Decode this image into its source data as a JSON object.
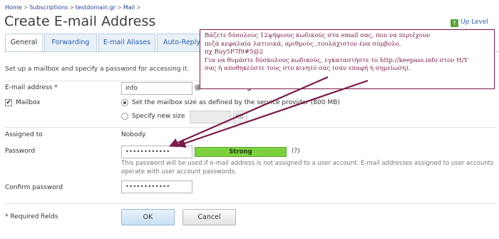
{
  "breadcrumb": {
    "items": [
      "Home",
      "Subscriptions",
      "testdomain.gr",
      "Mail"
    ],
    "separator": ">"
  },
  "page_title": "Create E-mail Address",
  "up_level": {
    "label": "Up Level",
    "icon": "up-level-icon"
  },
  "tabs": [
    {
      "label": "General",
      "active": true
    },
    {
      "label": "Forwarding",
      "active": false
    },
    {
      "label": "E-mail Aliases",
      "active": false
    },
    {
      "label": "Auto-Reply",
      "active": false
    }
  ],
  "intro": "Set up a mailbox and specify a password for accessing it.",
  "form": {
    "email": {
      "label": "E-mail address *",
      "value": "info",
      "domain": "@ testdomain.gr"
    },
    "mailbox": {
      "label": "Mailbox",
      "checked": true,
      "option_default": "Set the mailbox size as defined by the service provider (800 MB)",
      "option_custom": "Specify new size",
      "unit": "KB"
    },
    "assigned_to": {
      "label": "Assigned to",
      "value": "Nobody"
    },
    "password": {
      "label": "Password",
      "value": "••••••••••••",
      "strength": "Strong",
      "help": "(?)",
      "note": "This password will be used if e-mail address is not assigned to a user account. E-mail addresses assigned to user accounts operate with user account passwords."
    },
    "confirm_password": {
      "label": "Confirm password",
      "value": "••••••••••••"
    },
    "required_note": "* Required fields"
  },
  "buttons": {
    "ok": "OK",
    "cancel": "Cancel"
  },
  "callout": {
    "lines": [
      "Βάζετε δύσολους 12ψήφιους κωδικούς στα email σας, που να περιέχουν",
      "πεζά  κεφαλαία λατινικά, αριθμούς ,τουλάχιστον ένα σύμβολο.",
      "πχ Ruy5P7f9#5@2",
      "Για να θυμάστε δύσκολους κωδικούς, εγκαταστήστε το http://keepass.info στον Η/Υ",
      "σας ή αποθηκεύστε τους στο κινητό σας (σαν επαφή ή σημείωση)."
    ],
    "color": "#7a1a4a"
  },
  "colors": {
    "link": "#2a5db0",
    "strength_bar": "#7dd13f",
    "annotation": "#7a1a4a"
  }
}
